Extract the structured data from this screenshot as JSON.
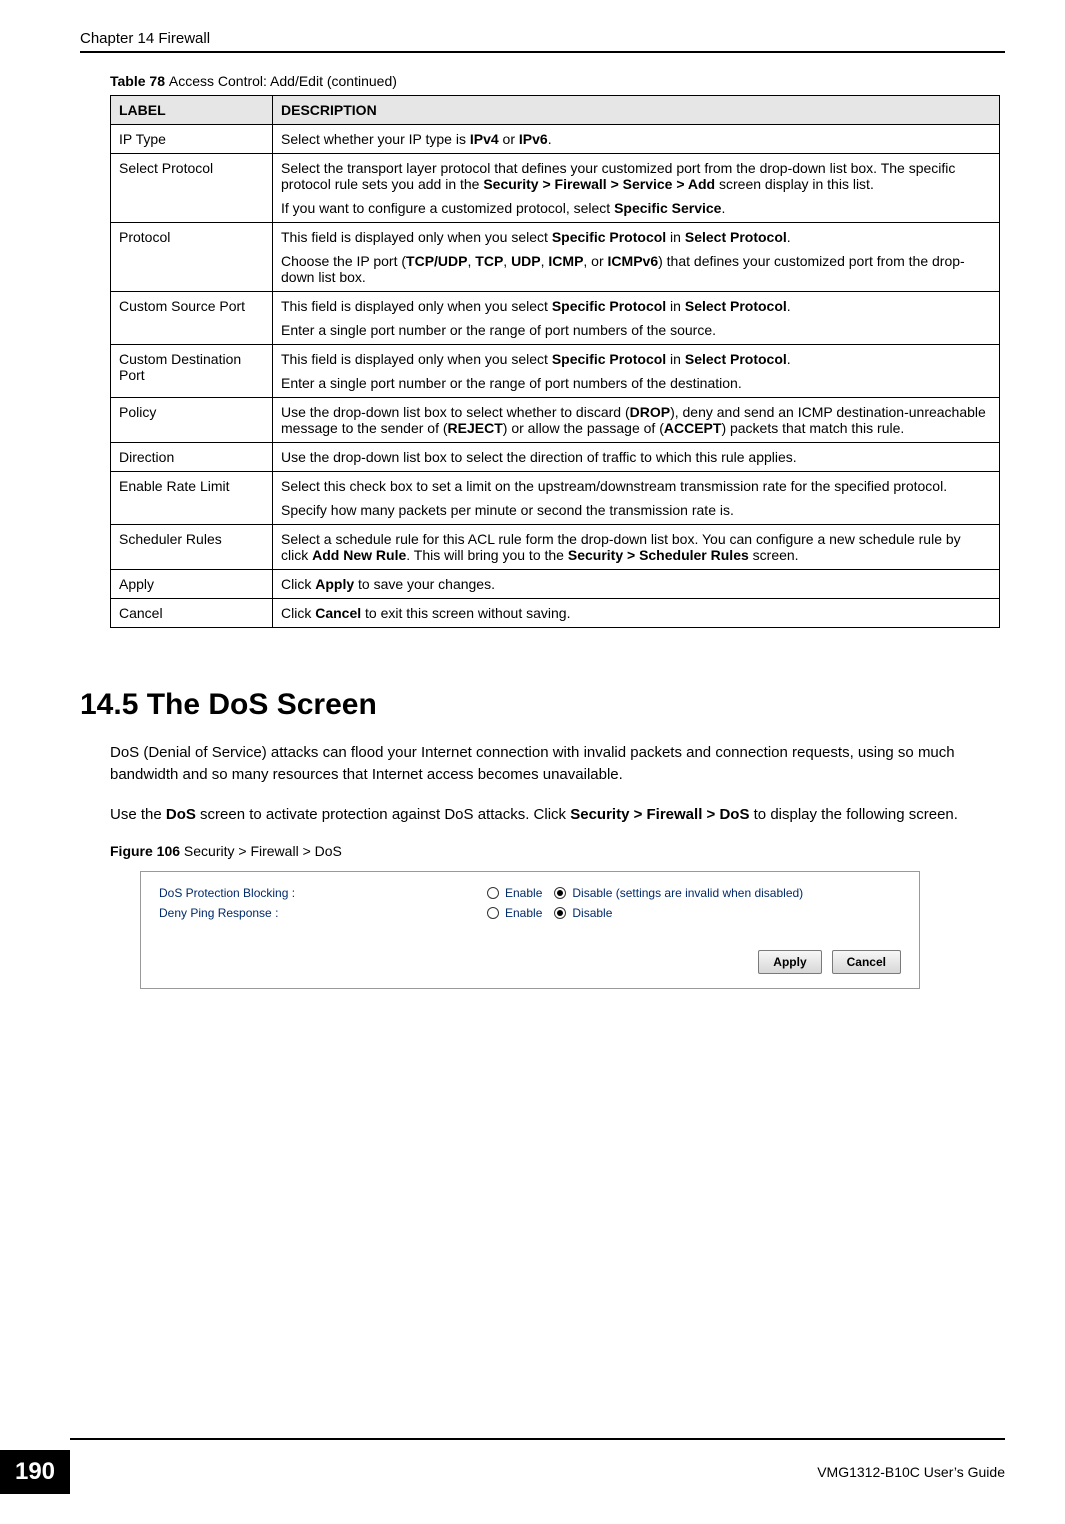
{
  "header": {
    "chapter": "Chapter 14 Firewall"
  },
  "table78": {
    "caption_prefix": "Table 78   ",
    "caption_title": "Access Control: Add/Edit (continued)",
    "headers": {
      "label": "LABEL",
      "description": "DESCRIPTION"
    },
    "rows": [
      {
        "label": "IP Type",
        "desc_pre": "Select whether your IP type is ",
        "b1": "IPv4",
        "mid": " or ",
        "b2": "IPv6",
        "post": "."
      },
      {
        "label": "Select Protocol",
        "p1_pre": "Select the transport layer protocol that defines your customized port from the drop-down list box. The specific protocol rule sets you add in the ",
        "p1_b1": "Security > Firewall > Service > Add",
        "p1_post": " screen display in this list.",
        "p2_pre": "If you want to configure a customized protocol, select ",
        "p2_b1": "Specific Service",
        "p2_post": "."
      },
      {
        "label": "Protocol",
        "p1_pre": "This field is displayed only when you select ",
        "p1_b1": "Specific Protocol",
        "p1_mid": " in ",
        "p1_b2": "Select Protocol",
        "p1_post": ".",
        "p2_pre": "Choose the IP port (",
        "p2_b1": "TCP/UDP",
        "p2_s1": ", ",
        "p2_b2": "TCP",
        "p2_s2": ", ",
        "p2_b3": "UDP",
        "p2_s3": ", ",
        "p2_b4": "ICMP",
        "p2_s4": ", or ",
        "p2_b5": "ICMPv6",
        "p2_post": ") that defines your customized port from the drop-down list box."
      },
      {
        "label": "Custom Source Port",
        "p1_pre": "This field is displayed only when you select ",
        "p1_b1": "Specific Protocol",
        "p1_mid": " in ",
        "p1_b2": "Select Protocol",
        "p1_post": ".",
        "p2": "Enter a single port number or the range of port numbers of the source."
      },
      {
        "label": "Custom Destination Port",
        "p1_pre": "This field is displayed only when you select ",
        "p1_b1": "Specific Protocol",
        "p1_mid": " in ",
        "p1_b2": "Select Protocol",
        "p1_post": ".",
        "p2": "Enter a single port number or the range of port numbers of the destination."
      },
      {
        "label": "Policy",
        "pre": "Use the drop-down list box to select whether to discard (",
        "b1": "DROP",
        "mid1": "), deny and send an ICMP destination-unreachable message to the sender of (",
        "b2": "REJECT",
        "mid2": ") or allow the passage of (",
        "b3": "ACCEPT",
        "post": ") packets that match this rule."
      },
      {
        "label": "Direction",
        "desc": "Use the drop-down list box to select the direction of traffic to which this rule applies."
      },
      {
        "label": "Enable Rate Limit",
        "p1": "Select this check box to set a limit on the upstream/downstream transmission rate for the specified protocol.",
        "p2": "Specify how many packets per minute or second the transmission rate is."
      },
      {
        "label": "Scheduler Rules",
        "pre": "Select a schedule rule for this ACL rule form the drop-down list box. You can configure a new schedule rule by click ",
        "b1": "Add New Rule",
        "mid": ". This will bring you to the ",
        "b2": "Security > Scheduler Rules",
        "post": " screen."
      },
      {
        "label": "Apply",
        "pre": "Click ",
        "b1": "Apply",
        "post": " to save your changes."
      },
      {
        "label": "Cancel",
        "pre": "Click ",
        "b1": "Cancel",
        "post": " to exit this screen without saving."
      }
    ]
  },
  "section": {
    "heading": "14.5  The DoS Screen",
    "para1": "DoS (Denial of Service) attacks can flood your Internet connection with invalid packets and connection requests, using so much bandwidth and so many resources that Internet access becomes unavailable.",
    "para2_pre": "Use the ",
    "para2_b1": "DoS",
    "para2_mid": " screen to activate protection against DoS attacks. Click ",
    "para2_b2": "Security > Firewall > DoS",
    "para2_post": " to display the following screen."
  },
  "figure": {
    "caption_prefix": "Figure 106   ",
    "caption_title": "Security > Firewall > DoS",
    "row1_label": "DoS Protection Blocking :",
    "row2_label": "Deny Ping Response :",
    "enable": "Enable",
    "disable": "Disable",
    "disable_note": "Disable (settings are invalid when disabled)",
    "apply": "Apply",
    "cancel": "Cancel"
  },
  "footer": {
    "page_number": "190",
    "guide": "VMG1312-B10C User’s Guide"
  }
}
